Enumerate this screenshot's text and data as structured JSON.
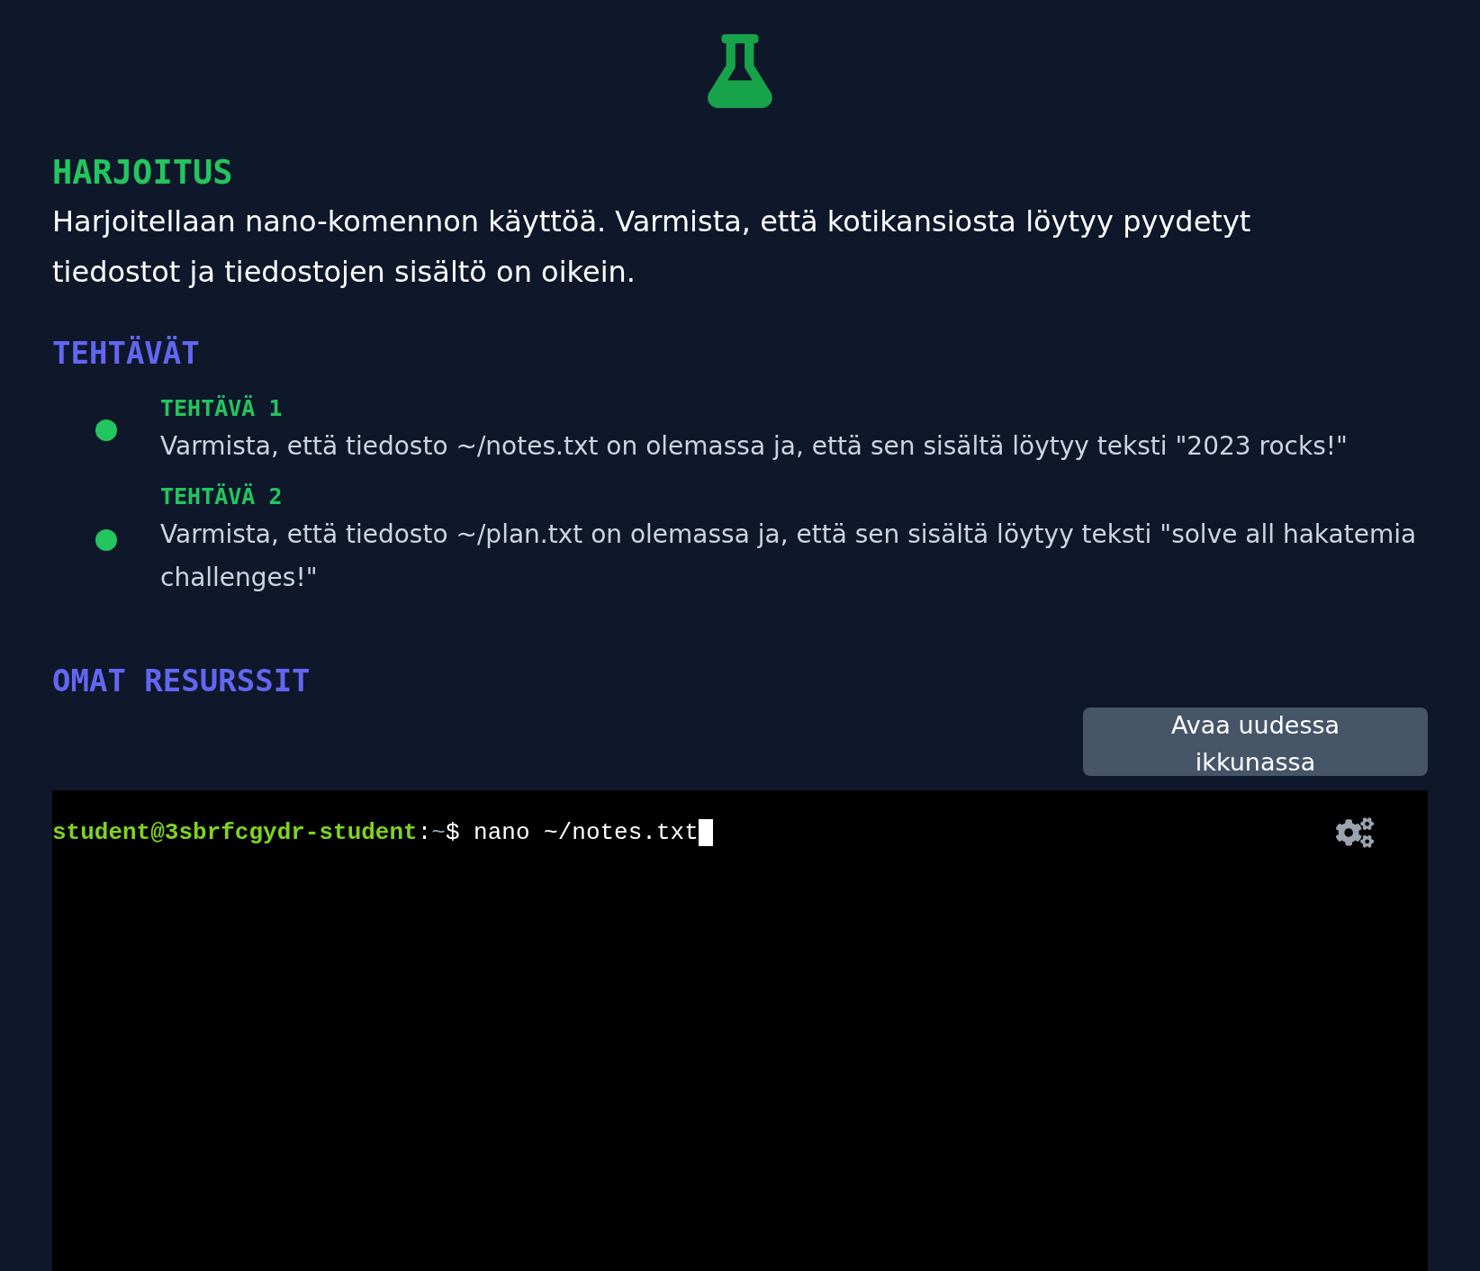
{
  "exercise": {
    "heading": "HARJOITUS",
    "description": "Harjoitellaan nano-komennon käyttöä. Varmista, että kotikansiosta löytyy pyydetyt tiedostot ja tiedostojen sisältö on oikein."
  },
  "tasks": {
    "heading": "TEHTÄVÄT",
    "items": [
      {
        "title": "TEHTÄVÄ 1",
        "text": "Varmista, että tiedosto ~/notes.txt on olemassa ja, että sen sisältä löytyy teksti \"2023 rocks!\"",
        "color": "#22c55e"
      },
      {
        "title": "TEHTÄVÄ 2",
        "text": "Varmista, että tiedosto ~/plan.txt on olemassa ja, että sen sisältä löytyy teksti \"solve all hakatemia challenges!\"",
        "color": "#22c55e"
      }
    ]
  },
  "resources": {
    "heading": "OMAT RESURSSIT",
    "open_button": "Avaa uudessa ikkunassa"
  },
  "terminal": {
    "user_host": "student@3sbrfcgydr-student",
    "separator": ":",
    "path": "~",
    "command": "$ nano ~/notes.txt"
  }
}
